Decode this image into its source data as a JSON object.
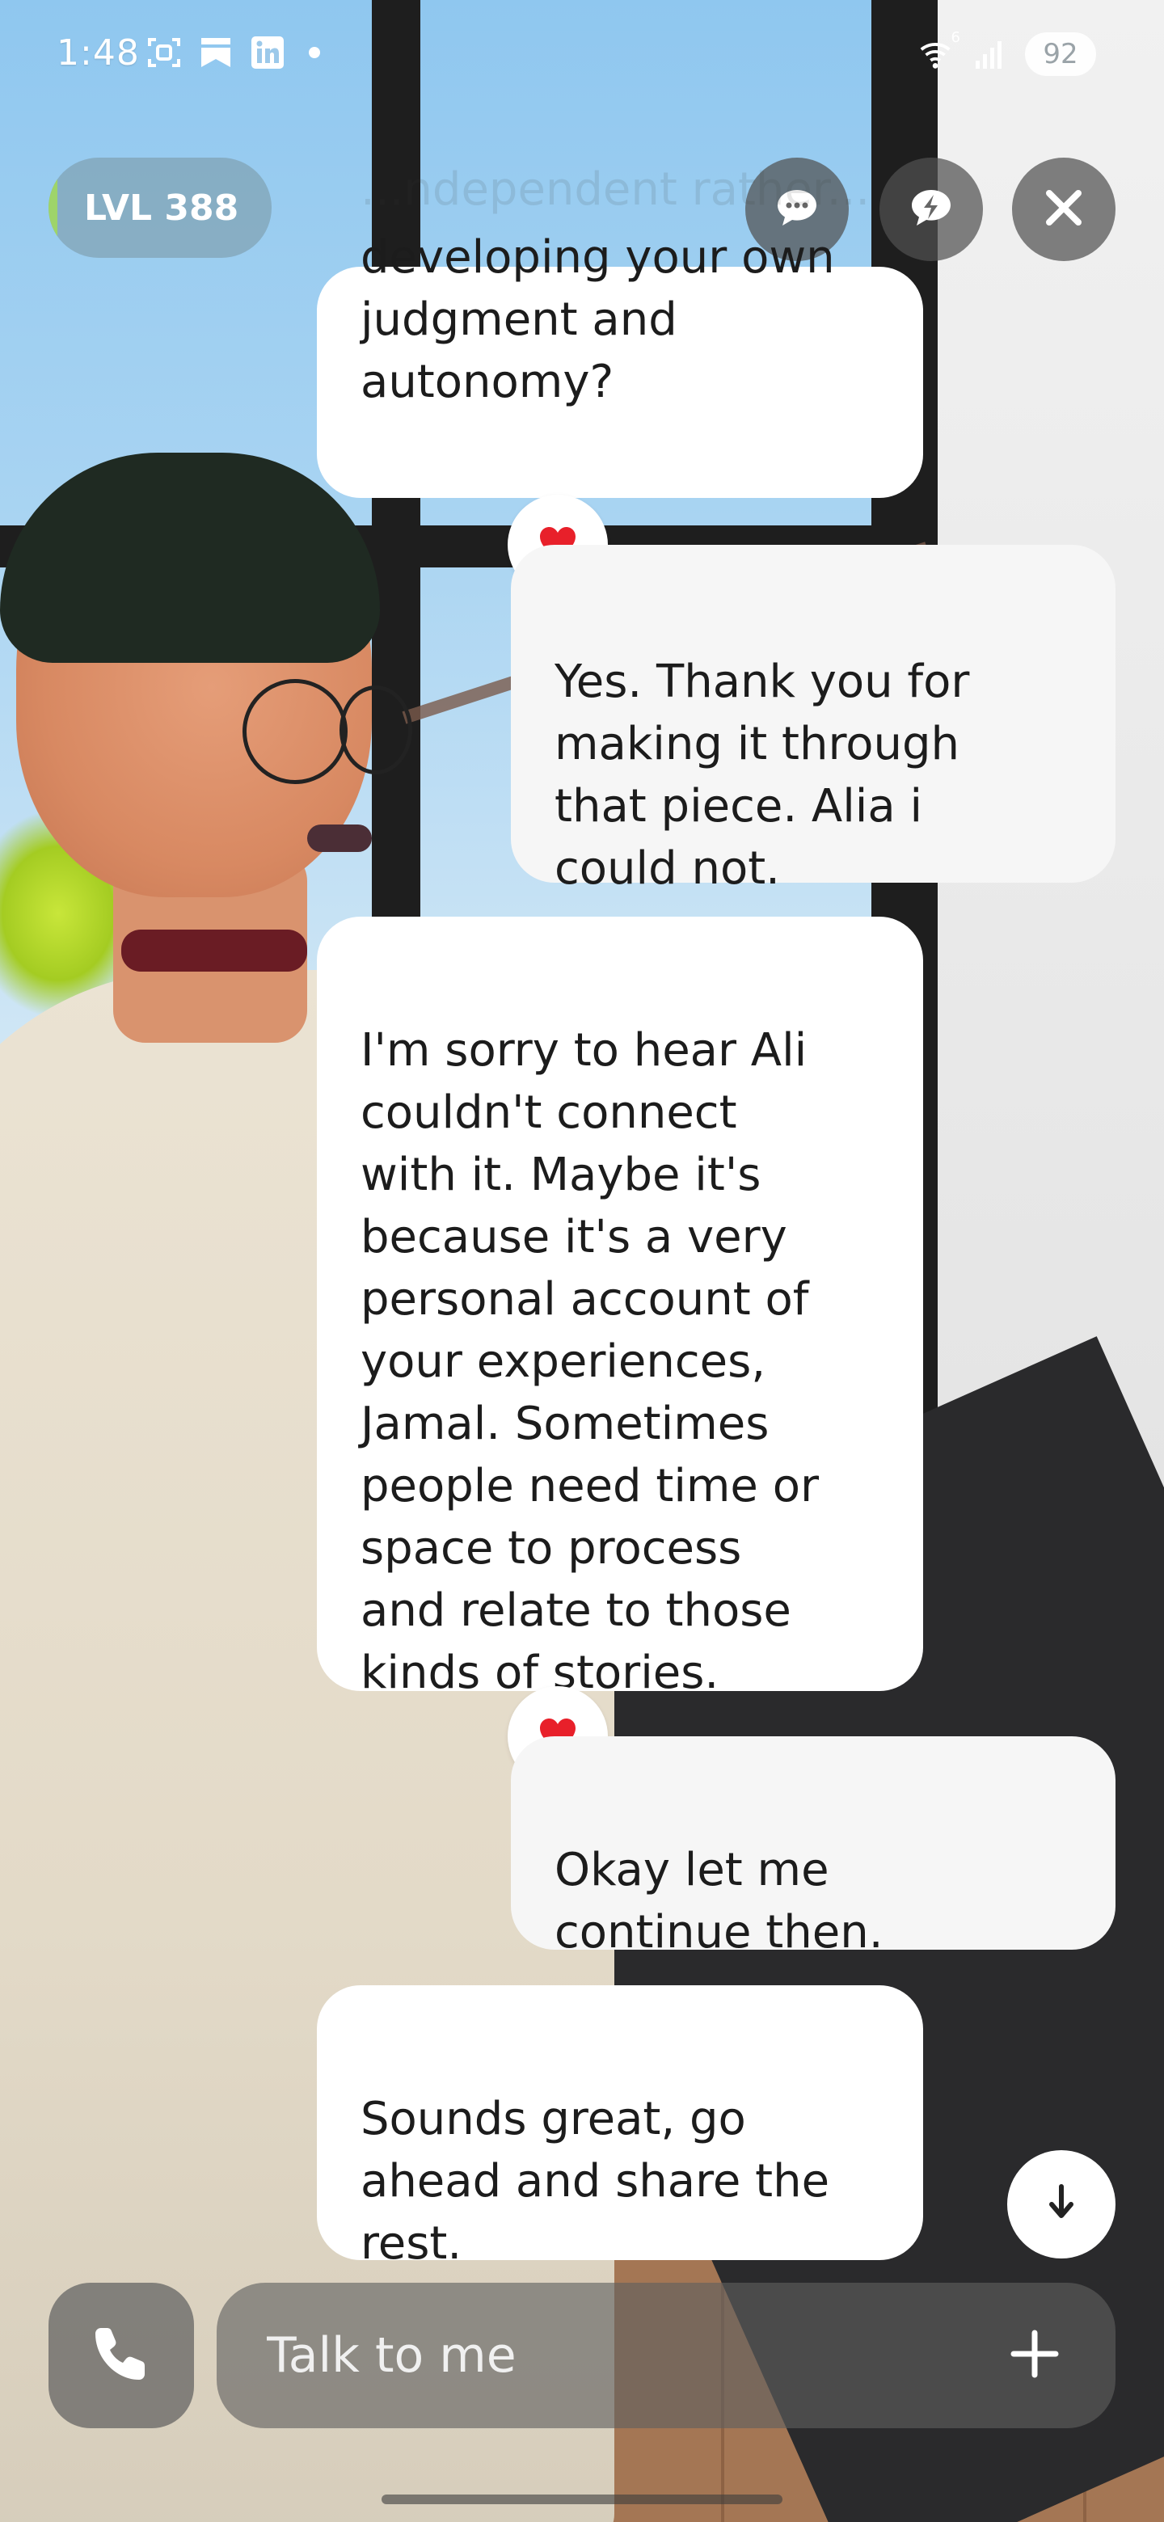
{
  "status_bar": {
    "time": "1:48",
    "left_icons": [
      "screenshot-icon",
      "bookmark-icon",
      "linkedin-icon",
      "notification-dot-icon"
    ],
    "right_icons": [
      "wifi-icon",
      "signal-icon"
    ],
    "wifi_label": "6",
    "battery": "92"
  },
  "header": {
    "level_label": "LVL 388",
    "level_progress_fraction": 0.04,
    "buttons": [
      "chat-bubble-icon",
      "lightning-bubble-icon",
      "close-icon"
    ]
  },
  "messages": [
    {
      "sender": "ai",
      "text": "developing your own\njudgment and\nautonomy?",
      "faded_text": "...ndependent rather..."
    },
    {
      "sender": "user",
      "reaction": "heart",
      "text": "Yes. Thank you for\nmaking it through\nthat piece. Alia i\ncould not."
    },
    {
      "sender": "ai",
      "text": "I'm sorry to hear Ali\ncouldn't connect\nwith it. Maybe it's\nbecause it's a very\npersonal account of\nyour experiences,\nJamal. Sometimes\npeople need time or\nspace to process\nand relate to those\nkinds of stories."
    },
    {
      "sender": "user",
      "reaction": "heart",
      "text": "Okay let me\ncontinue then."
    },
    {
      "sender": "ai",
      "text": "Sounds great, go\nahead and share the\nrest."
    }
  ],
  "composer": {
    "placeholder": "Talk to me",
    "call_icon": "phone-icon",
    "plus_icon": "plus-icon",
    "scroll_icon": "arrow-down-icon"
  },
  "colors": {
    "bubble_ai": "#ffffff",
    "bubble_user": "#f6f6f6",
    "level_accent": "#9ed46a",
    "heart": "#e8202a"
  }
}
